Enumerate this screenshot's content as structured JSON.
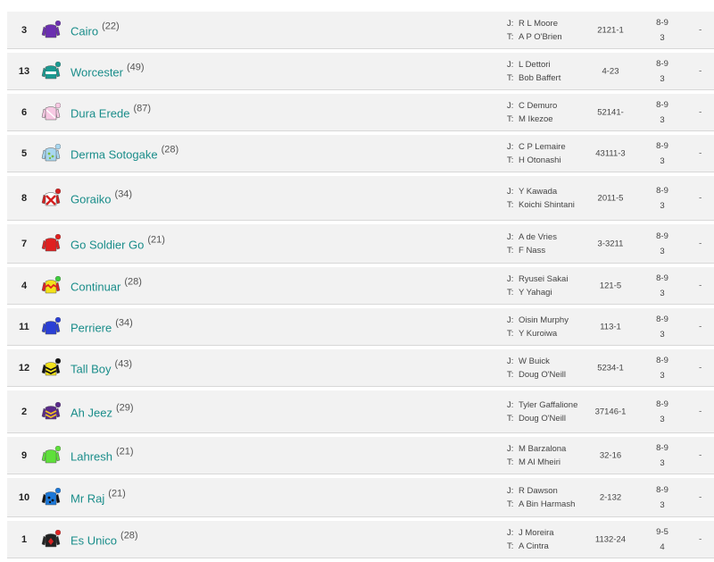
{
  "runners": [
    {
      "number": "3",
      "name": "Cairo",
      "age": "(22)",
      "jockey": "R L Moore",
      "trainer": "A P O'Brien",
      "form": "2121-1",
      "odds_top": "8-9",
      "odds_bottom": "3",
      "dash": "-",
      "silk": {
        "body": "#6b2fb0",
        "arms": "#6b2fb0",
        "pattern": "none",
        "accent": "#ffffff",
        "cap": "#6b2fb0"
      }
    },
    {
      "number": "13",
      "name": "Worcester",
      "age": "(49)",
      "jockey": "L Dettori",
      "trainer": "Bob Baffert",
      "form": "4-23",
      "odds_top": "8-9",
      "odds_bottom": "3",
      "dash": "-",
      "silk": {
        "body": "#1b9a91",
        "arms": "#1b9a91",
        "pattern": "band",
        "accent": "#ffffff",
        "cap": "#1b9a91"
      }
    },
    {
      "number": "6",
      "name": "Dura Erede",
      "age": "(87)",
      "jockey": "C Demuro",
      "trainer": "M Ikezoe",
      "form": "52141-",
      "odds_top": "8-9",
      "odds_bottom": "3",
      "dash": "-",
      "silk": {
        "body": "#f7c9e3",
        "arms": "#f7c9e3",
        "pattern": "diag",
        "accent": "#ffffff",
        "cap": "#f7c9e3"
      }
    },
    {
      "number": "5",
      "name": "Derma Sotogake",
      "age": "(28)",
      "jockey": "C P Lemaire",
      "trainer": "H Otonashi",
      "form": "43111-3",
      "odds_top": "8-9",
      "odds_bottom": "3",
      "dash": "-",
      "silk": {
        "body": "#a8d7f0",
        "arms": "#a8d7f0",
        "pattern": "dots",
        "accent": "#7dbb3e",
        "cap": "#a8d7f0"
      }
    },
    {
      "number": "8",
      "name": "Goraiko",
      "age": "(34)",
      "jockey": "Y Kawada",
      "trainer": "Koichi Shintani",
      "form": "2011-5",
      "odds_top": "8-9",
      "odds_bottom": "3",
      "dash": "-",
      "silk": {
        "body": "#ffffff",
        "arms": "#d42020",
        "pattern": "cross",
        "accent": "#d42020",
        "cap": "#d42020"
      }
    },
    {
      "number": "7",
      "name": "Go Soldier Go",
      "age": "(21)",
      "jockey": "A de Vries",
      "trainer": "F Nass",
      "form": "3-3211",
      "odds_top": "8-9",
      "odds_bottom": "3",
      "dash": "-",
      "silk": {
        "body": "#e02020",
        "arms": "#e02020",
        "pattern": "none",
        "accent": "#ffffff",
        "cap": "#e02020"
      }
    },
    {
      "number": "4",
      "name": "Continuar",
      "age": "(28)",
      "jockey": "Ryusei Sakai",
      "trainer": "Y Yahagi",
      "form": "121-5",
      "odds_top": "8-9",
      "odds_bottom": "3",
      "dash": "-",
      "silk": {
        "body": "#f3e21a",
        "arms": "#e02020",
        "pattern": "zigzag",
        "accent": "#e02020",
        "cap": "#3dcc3d"
      }
    },
    {
      "number": "11",
      "name": "Perriere",
      "age": "(34)",
      "jockey": "Oisin Murphy",
      "trainer": "Y Kuroiwa",
      "form": "113-1",
      "odds_top": "8-9",
      "odds_bottom": "3",
      "dash": "-",
      "silk": {
        "body": "#2a3fd6",
        "arms": "#2a3fd6",
        "pattern": "none",
        "accent": "#ffffff",
        "cap": "#2a3fd6"
      }
    },
    {
      "number": "12",
      "name": "Tall Boy",
      "age": "(43)",
      "jockey": "W Buick",
      "trainer": "Doug O'Neill",
      "form": "5234-1",
      "odds_top": "8-9",
      "odds_bottom": "3",
      "dash": "-",
      "silk": {
        "body": "#f2e21c",
        "arms": "#111111",
        "pattern": "chevrons",
        "accent": "#111111",
        "cap": "#111111"
      }
    },
    {
      "number": "2",
      "name": "Ah Jeez",
      "age": "(29)",
      "jockey": "Tyler Gaffalione",
      "trainer": "Doug O'Neill",
      "form": "37146-1",
      "odds_top": "8-9",
      "odds_bottom": "3",
      "dash": "-",
      "silk": {
        "body": "#5a2a8a",
        "arms": "#5a2a8a",
        "pattern": "chevrons",
        "accent": "#f0c020",
        "cap": "#5a2a8a"
      }
    },
    {
      "number": "9",
      "name": "Lahresh",
      "age": "(21)",
      "jockey": "M Barzalona",
      "trainer": "M Al Mheiri",
      "form": "32-16",
      "odds_top": "8-9",
      "odds_bottom": "3",
      "dash": "-",
      "silk": {
        "body": "#5ee03a",
        "arms": "#5ee03a",
        "pattern": "none",
        "accent": "#ffffff",
        "cap": "#5ee03a"
      }
    },
    {
      "number": "10",
      "name": "Mr Raj",
      "age": "(21)",
      "jockey": "R Dawson",
      "trainer": "A Bin Harmash",
      "form": "2-132",
      "odds_top": "8-9",
      "odds_bottom": "3",
      "dash": "-",
      "silk": {
        "body": "#1c78d8",
        "arms": "#111111",
        "pattern": "dots",
        "accent": "#111111",
        "cap": "#1c78d8"
      }
    },
    {
      "number": "1",
      "name": "Es Unico",
      "age": "(28)",
      "jockey": "J Moreira",
      "trainer": "A Cintra",
      "form": "1132-24",
      "odds_top": "9-5",
      "odds_bottom": "4",
      "dash": "-",
      "silk": {
        "body": "#222222",
        "arms": "#222222",
        "pattern": "diamond",
        "accent": "#d42020",
        "cap": "#e02020"
      }
    }
  ],
  "labels": {
    "jockey": "J:",
    "trainer": "T:"
  }
}
